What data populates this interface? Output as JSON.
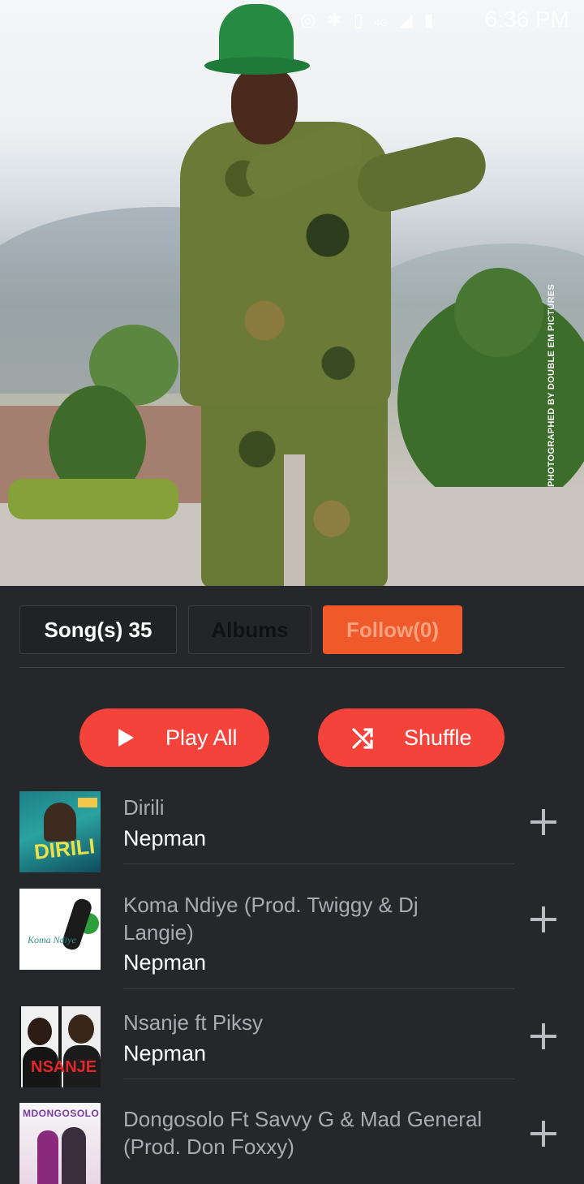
{
  "status_bar": {
    "time": "6:36 PM",
    "network": "4G",
    "icons": [
      "alarm-icon",
      "bluetooth-icon",
      "vibrate-icon",
      "signal-icon",
      "data-arrows-icon",
      "battery-charging-icon"
    ]
  },
  "hero": {
    "photo_credit": "PHOTOGRAPHED BY DOUBLE EM PICTURES"
  },
  "tabs": [
    {
      "label": "Song(s) 35",
      "active": true
    },
    {
      "label": "Albums",
      "active": false
    },
    {
      "label": "Follow(0)",
      "active": false
    }
  ],
  "actions": {
    "play_all": "Play All",
    "shuffle": "Shuffle"
  },
  "songs": [
    {
      "title": "Dirili",
      "artist": "Nepman",
      "cover_text": "DIRILI"
    },
    {
      "title": "Koma Ndiye (Prod. Twiggy & Dj Langie)",
      "artist": "Nepman",
      "cover_text": "Koma Ndiye"
    },
    {
      "title": "Nsanje ft Piksy",
      "artist": "Nepman",
      "cover_text": "NSANJE"
    },
    {
      "title": "Dongosolo Ft Savvy G & Mad General (Prod. Don Foxxy)",
      "artist": "",
      "cover_text": "MDONGOSOLO"
    }
  ],
  "colors": {
    "background": "#25272b",
    "accent_red": "#f3433a",
    "follow_orange": "#f0592a",
    "subtitle_gray": "#a9acb1"
  }
}
